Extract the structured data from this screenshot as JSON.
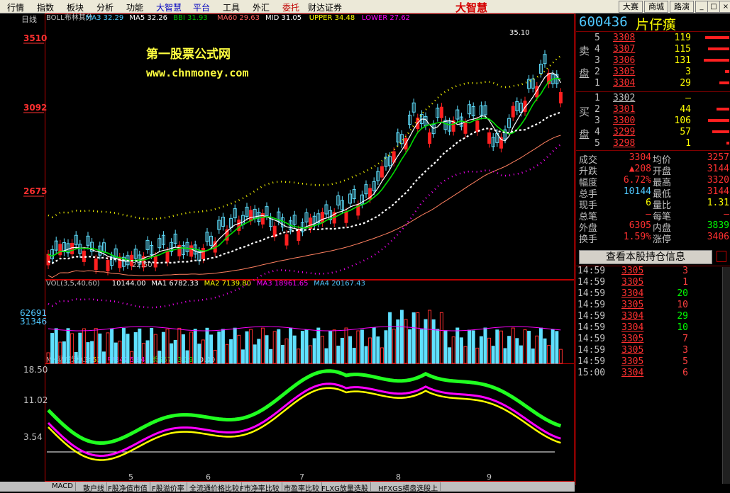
{
  "menu": [
    "行情",
    "指数",
    "板块",
    "分析",
    "功能",
    "大智慧",
    "平台",
    "工具",
    "外汇",
    "委托",
    "财达证券"
  ],
  "menu_colors": [
    "#000",
    "#000",
    "#000",
    "#000",
    "#000",
    "#0000c0",
    "#0000c0",
    "#000",
    "#000",
    "#c00000",
    "#000"
  ],
  "brand": "大智慧",
  "top_right_tabs": [
    "大赛",
    "商城",
    "路演"
  ],
  "window_buttons": [
    "_",
    "□",
    "×"
  ],
  "main_chart": {
    "period": "日线",
    "indicator_line": [
      {
        "text": "BOLL布林其分",
        "color": "#c0c0c0"
      },
      {
        "text": "MA3 32.29",
        "color": "#4fc8ff"
      },
      {
        "text": "MA5 32.26",
        "color": "#ffffff"
      },
      {
        "text": "BBI 31.93",
        "color": "#00c000"
      },
      {
        "text": "MA60 29.63",
        "color": "#ff6060"
      },
      {
        "text": "MID 31.05",
        "color": "#ffffff"
      },
      {
        "text": "UPPER 34.48",
        "color": "#ffff00"
      },
      {
        "text": "LOWER 27.62",
        "color": "#ff00ff"
      }
    ],
    "price_ticks": [
      "3510",
      "3092",
      "2675"
    ],
    "watermark_title": "第一股票公式网",
    "watermark_url": "www.chnmoney.com",
    "high_label": "35.10",
    "low_label": "22.50"
  },
  "volume_panel": {
    "indicator_line": [
      {
        "text": "VOL(3,5,40,60)",
        "color": "#c0c0c0"
      },
      {
        "text": "10144.00",
        "color": "#ffffff"
      },
      {
        "text": "MA1 6782.33",
        "color": "#ffffff"
      },
      {
        "text": "MA2 7139.80",
        "color": "#ffff00"
      },
      {
        "text": "MA3 18961.65",
        "color": "#ff00ff"
      },
      {
        "text": "MA4 20167.43",
        "color": "#4fc8ff"
      }
    ],
    "ticks": [
      "62691",
      "31346"
    ]
  },
  "indicator_panel": {
    "indicator_line": [
      {
        "text": "MH猛虎短A34",
        "color": "#c0c0c0"
      },
      {
        "text": "5.51",
        "color": "#ffff00"
      },
      {
        "text": "中B42",
        "color": "#ff00ff"
      },
      {
        "text": "6.64",
        "color": "#ff00ff"
      },
      {
        "text": "长S67",
        "color": "#00ff00"
      },
      {
        "text": "13.39",
        "color": "#00ff00"
      },
      {
        "text": "0.00",
        "color": "#ffffff"
      }
    ],
    "ticks": [
      "18.50",
      "11.02",
      "3.54"
    ],
    "month_labels": [
      "5",
      "6",
      "7",
      "8",
      "9"
    ]
  },
  "bottom_tabs": [
    "MACD",
    "散户线",
    "F股净值市值",
    "F股溢价率",
    "全流通价格比较",
    "F市净率比较",
    "市盈率比较",
    "FLXG放量选股",
    "HFXGS横盘选股上"
  ],
  "stock": {
    "code": "600436",
    "name": "片仔癀"
  },
  "order_book": {
    "sell_side_label": [
      "卖",
      "盘"
    ],
    "buy_side_label": [
      "买",
      "盘"
    ],
    "sell": [
      {
        "lvl": "5",
        "price": "3308",
        "vol": "119"
      },
      {
        "lvl": "4",
        "price": "3307",
        "vol": "115"
      },
      {
        "lvl": "3",
        "price": "3306",
        "vol": "131"
      },
      {
        "lvl": "2",
        "price": "3305",
        "vol": "3"
      },
      {
        "lvl": "1",
        "price": "3304",
        "vol": "29"
      }
    ],
    "buy": [
      {
        "lvl": "1",
        "price": "3302",
        "vol": "—"
      },
      {
        "lvl": "2",
        "price": "3301",
        "vol": "44"
      },
      {
        "lvl": "3",
        "price": "3300",
        "vol": "106"
      },
      {
        "lvl": "4",
        "price": "3299",
        "vol": "57"
      },
      {
        "lvl": "5",
        "price": "3298",
        "vol": "1"
      }
    ]
  },
  "stats": [
    {
      "l1": "成交",
      "v1": "3304",
      "l2": "均价",
      "v2": "3257"
    },
    {
      "l1": "升跌",
      "v1": "▲208",
      "l2": "开盘",
      "v2": "3144"
    },
    {
      "l1": "幅度",
      "v1": "6.72%",
      "l2": "最高",
      "v2": "3320"
    },
    {
      "l1": "总手",
      "v1": "10144",
      "l2": "最低",
      "v2": "3144"
    },
    {
      "l1": "现手",
      "v1": "6",
      "l2": "量比",
      "v2": "1.31"
    },
    {
      "l1": "总笔",
      "v1": "—",
      "l2": "每笔",
      "v2": "—"
    },
    {
      "l1": "外盘",
      "v1": "6305",
      "l2": "内盘",
      "v2": "3839"
    },
    {
      "l1": "换手",
      "v1": "1.59%",
      "l2": "涨停",
      "v2": "3406"
    }
  ],
  "holdings_button": "查看本股持仓信息",
  "ticks_list": [
    {
      "time": "14:59",
      "price": "3305",
      "vol": "3",
      "c": "#ff4040"
    },
    {
      "time": "14:59",
      "price": "3305",
      "vol": "1",
      "c": "#ff4040"
    },
    {
      "time": "14:59",
      "price": "3304",
      "vol": "20",
      "c": "#00ff00"
    },
    {
      "time": "14:59",
      "price": "3305",
      "vol": "10",
      "c": "#ff4040"
    },
    {
      "time": "14:59",
      "price": "3304",
      "vol": "29",
      "c": "#00ff00"
    },
    {
      "time": "14:59",
      "price": "3304",
      "vol": "10",
      "c": "#00ff00"
    },
    {
      "time": "14:59",
      "price": "3305",
      "vol": "7",
      "c": "#ff4040"
    },
    {
      "time": "14:59",
      "price": "3305",
      "vol": "3",
      "c": "#ff4040"
    },
    {
      "time": "14:59",
      "price": "3305",
      "vol": "5",
      "c": "#ff4040"
    },
    {
      "time": "15:00",
      "price": "3304",
      "vol": "6",
      "c": "#ff4040"
    }
  ]
}
